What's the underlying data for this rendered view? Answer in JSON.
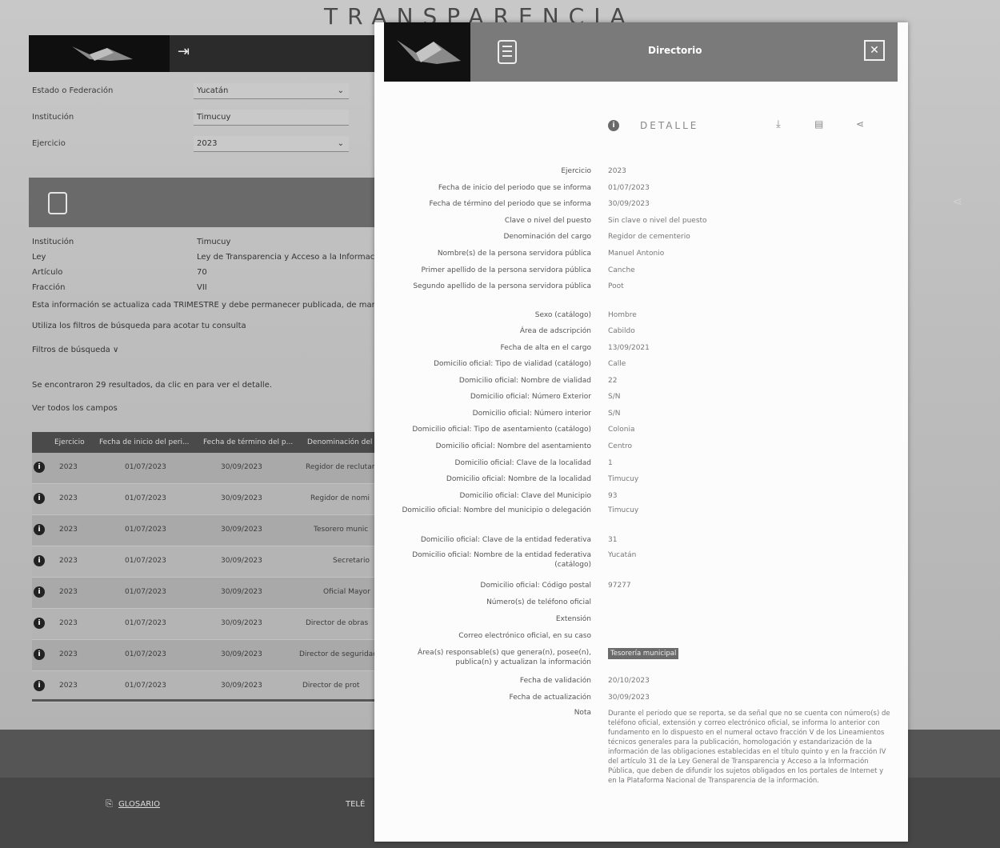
{
  "brand": "TRANSPARENCIA",
  "filters": [
    {
      "label": "Estado o Federación",
      "value": "Yucatán"
    },
    {
      "label": "Institución",
      "value": "Timucuy"
    },
    {
      "label": "Ejercicio",
      "value": "2023"
    }
  ],
  "info": [
    {
      "label": "Institución",
      "value": "Timucuy"
    },
    {
      "label": "Ley",
      "value": "Ley de Transparencia y Acceso a la Información"
    },
    {
      "label": "Artículo",
      "value": "70"
    },
    {
      "label": "Fracción",
      "value": "VII"
    }
  ],
  "note_line": "Esta información se actualiza cada TRIMESTRE y debe permanecer publicada, de manera",
  "hint": "Utiliza los filtros de búsqueda para acotar tu consulta",
  "filters_toggle": "Filtros de búsqueda ∨",
  "results_text": "Se encontraron 29 resultados, da clic en  para ver el detalle.",
  "ver_todos": "Ver todos los campos",
  "table": {
    "headers": [
      "Ejercicio",
      "Fecha de inicio del peri...",
      "Fecha de término del p...",
      "Denominación del"
    ],
    "rows": [
      [
        "2023",
        "01/07/2023",
        "30/09/2023",
        "Regidor de reclutami"
      ],
      [
        "2023",
        "01/07/2023",
        "30/09/2023",
        "Regidor de nomi"
      ],
      [
        "2023",
        "01/07/2023",
        "30/09/2023",
        "Tesorero munic"
      ],
      [
        "2023",
        "01/07/2023",
        "30/09/2023",
        "Secretario"
      ],
      [
        "2023",
        "01/07/2023",
        "30/09/2023",
        "Oficial Mayor"
      ],
      [
        "2023",
        "01/07/2023",
        "30/09/2023",
        "Director de obras"
      ],
      [
        "2023",
        "01/07/2023",
        "30/09/2023",
        "Director de seguridad"
      ],
      [
        "2023",
        "01/07/2023",
        "30/09/2023",
        "Director de prot"
      ]
    ]
  },
  "footer": {
    "glosario": "GLOSARIO",
    "telefono": "TELÉ"
  },
  "modal": {
    "title": "Directorio",
    "close": "✕",
    "detalle": "DETALLE",
    "fields": [
      {
        "label": "Ejercicio",
        "value": "2023"
      },
      {
        "label": "Fecha de inicio del periodo que se informa",
        "value": "01/07/2023"
      },
      {
        "label": "Fecha de término del periodo que se informa",
        "value": "30/09/2023"
      },
      {
        "label": "Clave o nivel del puesto",
        "value": "Sin clave o nivel del puesto"
      },
      {
        "label": "Denominación del cargo",
        "value": "Regidor de cementerio"
      },
      {
        "label": "Nombre(s) de la persona servidora pública",
        "value": "Manuel Antonio"
      },
      {
        "label": "Primer apellido de la persona servidora pública",
        "value": "Canche"
      },
      {
        "label": "Segundo apellido de la persona servidora pública",
        "value": "Poot"
      },
      {
        "label": "Sexo (catálogo)",
        "value": "Hombre"
      },
      {
        "label": "Área de adscripción",
        "value": "Cabildo"
      },
      {
        "label": "Fecha de alta en el cargo",
        "value": "13/09/2021"
      },
      {
        "label": "Domicilio oficial: Tipo de vialidad (catálogo)",
        "value": "Calle"
      },
      {
        "label": "Domicilio oficial: Nombre de vialidad",
        "value": "22"
      },
      {
        "label": "Domicilio oficial: Número Exterior",
        "value": "S/N"
      },
      {
        "label": "Domicilio oficial: Número interior",
        "value": "S/N"
      },
      {
        "label": "Domicilio oficial: Tipo de asentamiento (catálogo)",
        "value": "Colonia"
      },
      {
        "label": "Domicilio oficial: Nombre del asentamiento",
        "value": "Centro"
      },
      {
        "label": "Domicilio oficial: Clave de la localidad",
        "value": "1"
      },
      {
        "label": "Domicilio oficial: Nombre de la localidad",
        "value": "Timucuy"
      },
      {
        "label": "Domicilio oficial: Clave del Municipio",
        "value": "93"
      },
      {
        "label": "Domicilio oficial: Nombre del municipio o delegación",
        "value": "Timucuy"
      },
      {
        "label": "Domicilio oficial: Clave de la entidad federativa",
        "value": "31"
      },
      {
        "label": "Domicilio oficial: Nombre de la entidad federativa (catálogo)",
        "value": "Yucatán"
      },
      {
        "label": "Domicilio oficial: Código postal",
        "value": "97277"
      },
      {
        "label": "Número(s) de teléfono oficial",
        "value": ""
      },
      {
        "label": "Extensión",
        "value": ""
      },
      {
        "label": "Correo electrónico oficial, en su caso",
        "value": ""
      },
      {
        "label": "Área(s) responsable(s) que genera(n), posee(n), publica(n) y actualizan la información",
        "value": "Tesorería municipal"
      },
      {
        "label": "Fecha de validación",
        "value": "20/10/2023"
      },
      {
        "label": "Fecha de actualización",
        "value": "30/09/2023"
      }
    ],
    "nota_label": "Nota",
    "nota": "Durante el periodo que se reporta, se da señal que no se cuenta con número(s) de teléfono oficial, extensión y correo electrónico oficial, se informa lo anterior con fundamento en lo dispuesto en el numeral octavo fracción V de los Lineamientos técnicos generales para la publicación, homologación y estandarización de la información de las obligaciones establecidas en el título quinto y en la fracción IV del artículo 31 de la Ley General de Transparencia y Acceso a la Información Pública, que deben de difundir los sujetos obligados en los portales de Internet y en la Plataforma Nacional de Transparencia de la información."
  }
}
